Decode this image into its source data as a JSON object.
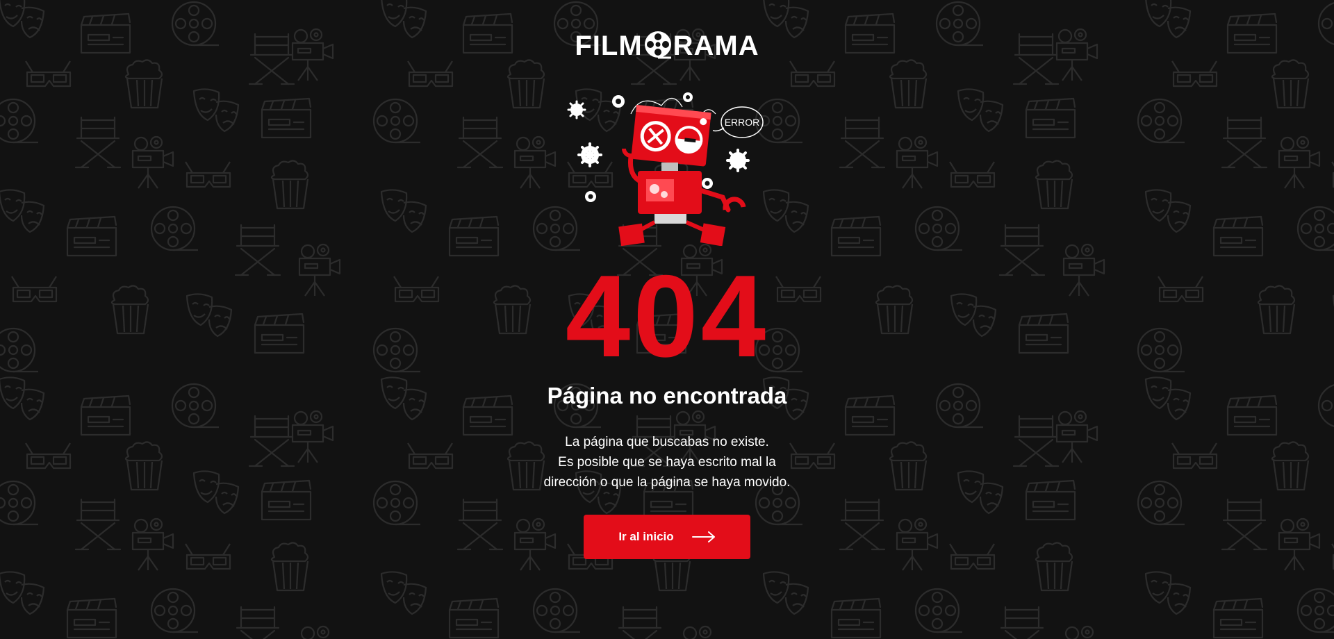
{
  "logo": {
    "left": "FILM",
    "right": "RAMA"
  },
  "illustration": {
    "bubble_text": "ERROR",
    "icon": "broken-robot-icon"
  },
  "error": {
    "code": "404",
    "title": "Página no encontrada",
    "description_lines": [
      "La página que buscabas no existe.",
      "Es posible que se haya escrito mal la",
      "dirección o que la página se haya movido."
    ]
  },
  "cta": {
    "label": "Ir al inicio",
    "icon": "arrow-right-icon"
  },
  "colors": {
    "background": "#121212",
    "accent": "#e30d19",
    "pattern": "#2a2a2a",
    "text": "#ffffff"
  }
}
